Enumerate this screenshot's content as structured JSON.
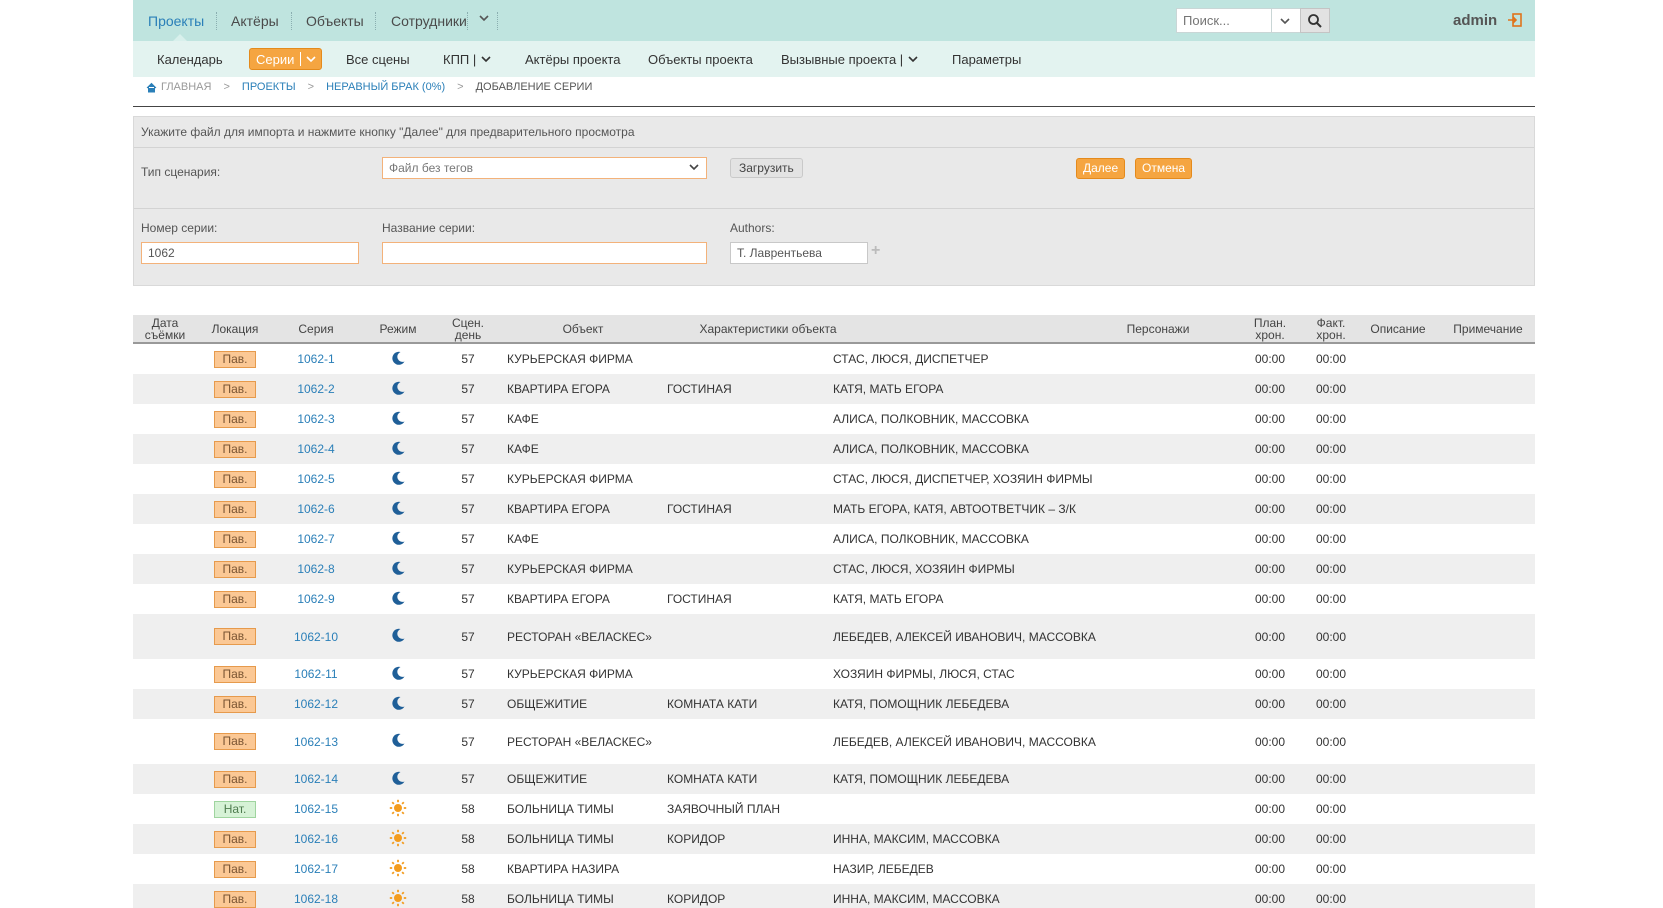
{
  "topnav": {
    "items": [
      "Проекты",
      "Актёры",
      "Объекты",
      "Сотрудники"
    ],
    "search_placeholder": "Поиск...",
    "user": "admin"
  },
  "subnav": {
    "items": [
      "Календарь",
      "Серии",
      "Все сцены",
      "КПП |",
      "Актёры проекта",
      "Объекты проекта",
      "Вызывные проекта |",
      "Параметры"
    ]
  },
  "breadcrumb": [
    "ГЛАВНАЯ",
    ">",
    "ПРОЕКТЫ",
    ">",
    "НЕРАВНЫЙ БРАК (0%)",
    ">",
    "ДОБАВЛЕНИЕ СЕРИИ"
  ],
  "form": {
    "hint": "Укажите файл для импорта и нажмите кнопку \"Далее\" для предварительного просмотра",
    "scenario_type_label": "Тип сценария:",
    "scenario_type_value": "Файл без тегов",
    "upload_label": "Загрузить",
    "next_label": "Далее",
    "cancel_label": "Отмена",
    "series_number_label": "Номер серии:",
    "series_number_value": "1062",
    "series_name_label": "Название серии:",
    "series_name_value": "",
    "authors_label": "Authors:",
    "authors_value": "Т. Лаврентьева"
  },
  "table": {
    "headers": [
      "Дата съёмки",
      "Локация",
      "Серия",
      "Режим",
      "Сцен. день",
      "Объект",
      "Характеристики объекта",
      "Персонажи",
      "План. хрон.",
      "Факт. хрон.",
      "Описание",
      "Примечание"
    ],
    "rows": [
      {
        "loc": "Пав.",
        "series": "1062-1",
        "mode": "night",
        "day": "57",
        "object": "КУРЬЕРСКАЯ ФИРМА",
        "chars": "",
        "persons": "СТАС, ЛЮСЯ, ДИСПЕТЧЕР",
        "plan": "00:00",
        "fact": "00:00"
      },
      {
        "loc": "Пав.",
        "series": "1062-2",
        "mode": "night",
        "day": "57",
        "object": "КВАРТИРА ЕГОРА",
        "chars": "ГОСТИНАЯ",
        "persons": "КАТЯ, МАТЬ ЕГОРА",
        "plan": "00:00",
        "fact": "00:00"
      },
      {
        "loc": "Пав.",
        "series": "1062-3",
        "mode": "night",
        "day": "57",
        "object": "КАФЕ",
        "chars": "",
        "persons": "АЛИСА, ПОЛКОВНИК, МАССОВКА",
        "plan": "00:00",
        "fact": "00:00"
      },
      {
        "loc": "Пав.",
        "series": "1062-4",
        "mode": "night",
        "day": "57",
        "object": "КАФЕ",
        "chars": "",
        "persons": "АЛИСА, ПОЛКОВНИК, МАССОВКА",
        "plan": "00:00",
        "fact": "00:00"
      },
      {
        "loc": "Пав.",
        "series": "1062-5",
        "mode": "night",
        "day": "57",
        "object": "КУРЬЕРСКАЯ ФИРМА",
        "chars": "",
        "persons": "СТАС, ЛЮСЯ, ДИСПЕТЧЕР, ХОЗЯИН ФИРМЫ",
        "plan": "00:00",
        "fact": "00:00"
      },
      {
        "loc": "Пав.",
        "series": "1062-6",
        "mode": "night",
        "day": "57",
        "object": "КВАРТИРА ЕГОРА",
        "chars": "ГОСТИНАЯ",
        "persons": "МАТЬ ЕГОРА, КАТЯ, АВТООТВЕТЧИК – З/К",
        "plan": "00:00",
        "fact": "00:00"
      },
      {
        "loc": "Пав.",
        "series": "1062-7",
        "mode": "night",
        "day": "57",
        "object": "КАФЕ",
        "chars": "",
        "persons": "АЛИСА, ПОЛКОВНИК, МАССОВКА",
        "plan": "00:00",
        "fact": "00:00"
      },
      {
        "loc": "Пав.",
        "series": "1062-8",
        "mode": "night",
        "day": "57",
        "object": "КУРЬЕРСКАЯ ФИРМА",
        "chars": "",
        "persons": "СТАС, ЛЮСЯ, ХОЗЯИН ФИРМЫ",
        "plan": "00:00",
        "fact": "00:00"
      },
      {
        "loc": "Пав.",
        "series": "1062-9",
        "mode": "night",
        "day": "57",
        "object": "КВАРТИРА ЕГОРА",
        "chars": "ГОСТИНАЯ",
        "persons": "КАТЯ, МАТЬ ЕГОРА",
        "plan": "00:00",
        "fact": "00:00"
      },
      {
        "loc": "Пав.",
        "series": "1062-10",
        "mode": "night",
        "day": "57",
        "object": "РЕСТОРАН «ВЕЛАСКЕС»",
        "chars": "",
        "persons": "ЛЕБЕДЕВ, АЛЕКСЕЙ ИВАНОВИЧ, МАССОВКА",
        "plan": "00:00",
        "fact": "00:00",
        "tall": true
      },
      {
        "loc": "Пав.",
        "series": "1062-11",
        "mode": "night",
        "day": "57",
        "object": "КУРЬЕРСКАЯ ФИРМА",
        "chars": "",
        "persons": "ХОЗЯИН ФИРМЫ, ЛЮСЯ, СТАС",
        "plan": "00:00",
        "fact": "00:00"
      },
      {
        "loc": "Пав.",
        "series": "1062-12",
        "mode": "night",
        "day": "57",
        "object": "ОБЩЕЖИТИЕ",
        "chars": "КОМНАТА КАТИ",
        "persons": "КАТЯ, ПОМОЩНИК ЛЕБЕДЕВА",
        "plan": "00:00",
        "fact": "00:00"
      },
      {
        "loc": "Пав.",
        "series": "1062-13",
        "mode": "night",
        "day": "57",
        "object": "РЕСТОРАН «ВЕЛАСКЕС»",
        "chars": "",
        "persons": "ЛЕБЕДЕВ, АЛЕКСЕЙ ИВАНОВИЧ, МАССОВКА",
        "plan": "00:00",
        "fact": "00:00",
        "tall": true
      },
      {
        "loc": "Пав.",
        "series": "1062-14",
        "mode": "night",
        "day": "57",
        "object": "ОБЩЕЖИТИЕ",
        "chars": "КОМНАТА КАТИ",
        "persons": "КАТЯ, ПОМОЩНИК ЛЕБЕДЕВА",
        "plan": "00:00",
        "fact": "00:00"
      },
      {
        "loc": "Нат.",
        "series": "1062-15",
        "mode": "day",
        "day": "58",
        "object": "БОЛЬНИЦА ТИМЫ",
        "chars": "ЗАЯВОЧНЫЙ ПЛАН",
        "persons": "",
        "plan": "00:00",
        "fact": "00:00"
      },
      {
        "loc": "Пав.",
        "series": "1062-16",
        "mode": "day",
        "day": "58",
        "object": "БОЛЬНИЦА ТИМЫ",
        "chars": "КОРИДОР",
        "persons": "ИННА, МАКСИМ, МАССОВКА",
        "plan": "00:00",
        "fact": "00:00"
      },
      {
        "loc": "Пав.",
        "series": "1062-17",
        "mode": "day",
        "day": "58",
        "object": "КВАРТИРА НАЗИРА",
        "chars": "",
        "persons": "НАЗИР, ЛЕБЕДЕВ",
        "plan": "00:00",
        "fact": "00:00"
      },
      {
        "loc": "Пав.",
        "series": "1062-18",
        "mode": "day",
        "day": "58",
        "object": "БОЛЬНИЦА ТИМЫ",
        "chars": "КОРИДОР",
        "persons": "ИННА, МАКСИМ, МАССОВКА",
        "plan": "00:00",
        "fact": "00:00"
      }
    ]
  },
  "colors": {
    "topbar": "#bfe4df",
    "subbar": "#e3f3f0",
    "accent_orange": "#f5a541",
    "link_blue": "#2a7fb8",
    "night_icon": "#1f5f98",
    "day_icon": "#f39c1f"
  }
}
